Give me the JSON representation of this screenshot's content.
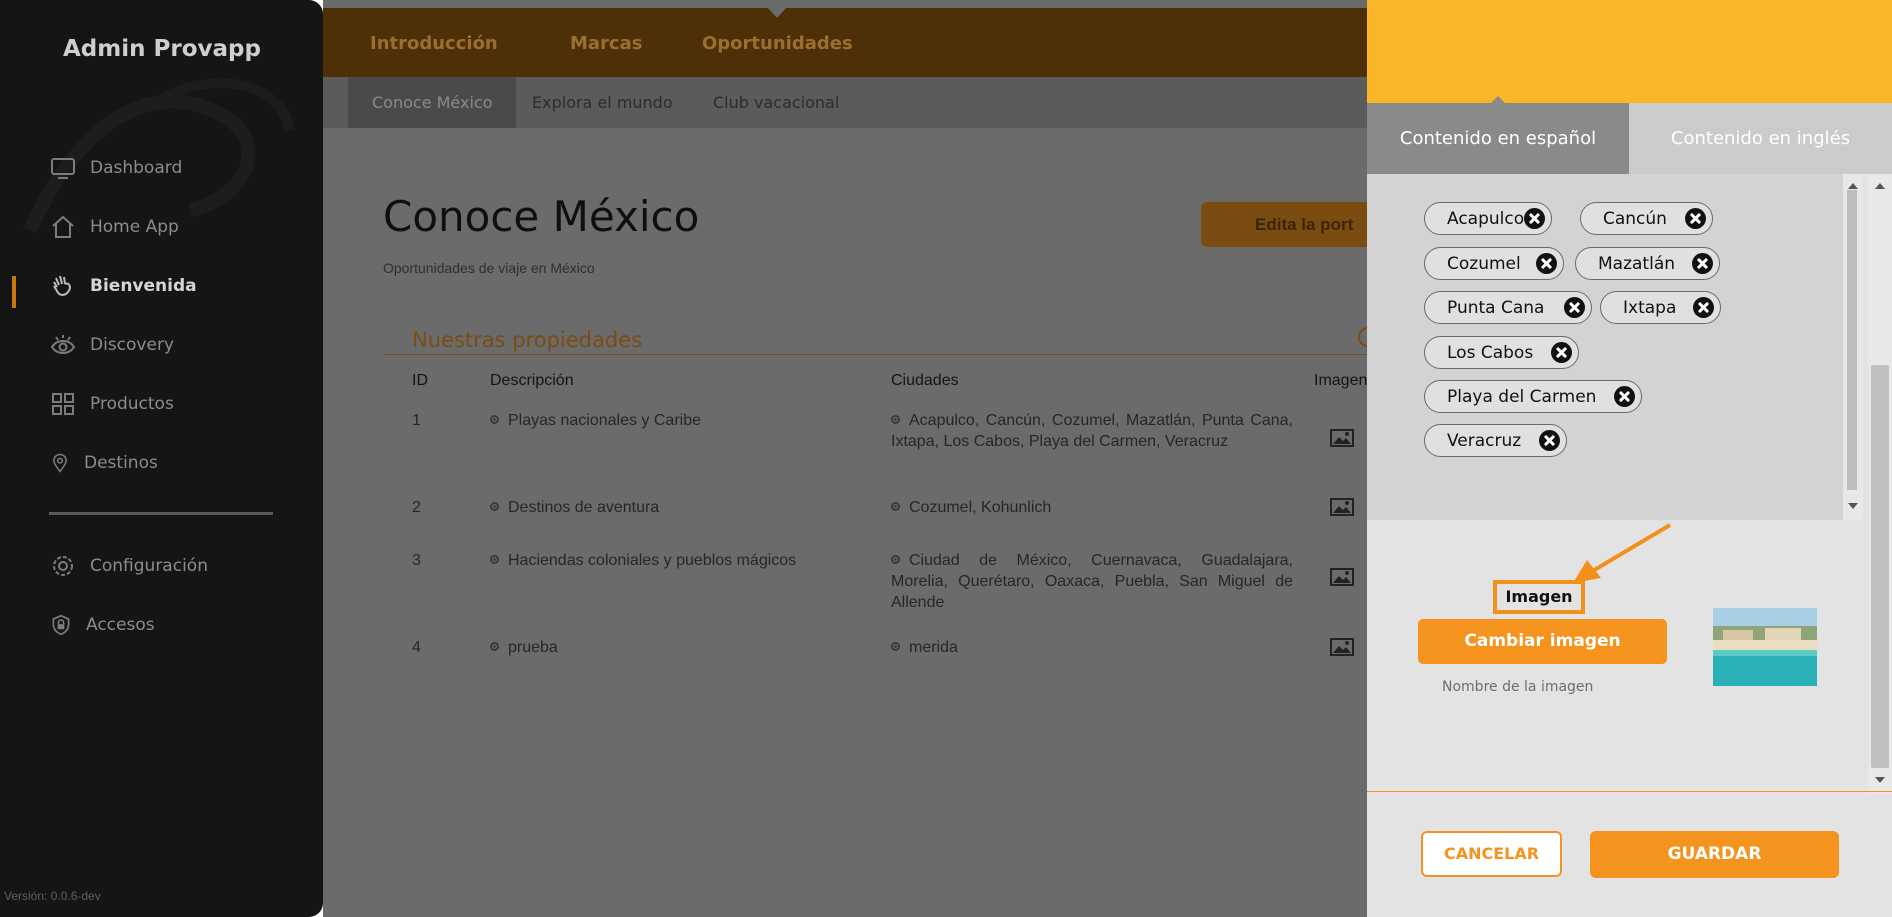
{
  "sidebar": {
    "brand": "Admin Provapp",
    "items": [
      {
        "label": "Dashboard",
        "icon": "monitor-icon"
      },
      {
        "label": "Home App",
        "icon": "home-icon"
      },
      {
        "label": "Bienvenida",
        "icon": "wave-hand-icon",
        "active": true
      },
      {
        "label": "Discovery",
        "icon": "eye-icon"
      },
      {
        "label": "Productos",
        "icon": "grid-icon"
      },
      {
        "label": "Destinos",
        "icon": "map-pin-icon"
      },
      {
        "label": "Configuración",
        "icon": "gear-icon"
      },
      {
        "label": "Accesos",
        "icon": "shield-lock-icon"
      }
    ],
    "version": "Versión: 0.0.6-dev"
  },
  "topnav": {
    "tabs": [
      "Introducción",
      "Marcas",
      "Oportunidades"
    ],
    "subtabs": [
      "Conoce México",
      "Explora el mundo",
      "Club vacacional"
    ]
  },
  "main": {
    "title": "Conoce México",
    "subtitle": "Oportunidades de viaje en México",
    "edit_button": "Edita la port",
    "section_title": "Nuestras propiedades",
    "table": {
      "headers": [
        "ID",
        "Descripción",
        "Ciudades",
        "Imagen"
      ],
      "rows": [
        {
          "id": "1",
          "description": "Playas nacionales y Caribe",
          "cities": "Acapulco, Cancún, Cozumel, Mazatlán, Punta Cana, Ixtapa, Los Cabos, Playa del Carmen, Veracruz"
        },
        {
          "id": "2",
          "description": "Destinos de aventura",
          "cities": "Cozumel, Kohunlich"
        },
        {
          "id": "3",
          "description": "Haciendas coloniales y pueblos mágicos",
          "cities": "Ciudad de México, Cuernavaca, Guadalajara, Morelia, Querétaro, Oaxaca, Puebla, San Miguel de Allende"
        },
        {
          "id": "4",
          "description": "prueba",
          "cities": "merida"
        }
      ]
    }
  },
  "panel": {
    "tabs": [
      "Contenido en español",
      "Contenido en inglés"
    ],
    "tags": [
      "Acapulco",
      "Cancún",
      "Cozumel",
      "Mazatlán",
      "Punta Cana",
      "Ixtapa",
      "Los Cabos",
      "Playa del Carmen",
      "Veracruz"
    ],
    "image_label": "Imagen",
    "change_image_button": "Cambiar imagen",
    "image_name_label": "Nombre de la imagen",
    "cancel_button": "CANCELAR",
    "save_button": "GUARDAR"
  },
  "colors": {
    "accent": "#f4941f",
    "panel_header": "#f9b628",
    "sidebar": "#151515",
    "overlay_bg": "#6b6b6b"
  }
}
